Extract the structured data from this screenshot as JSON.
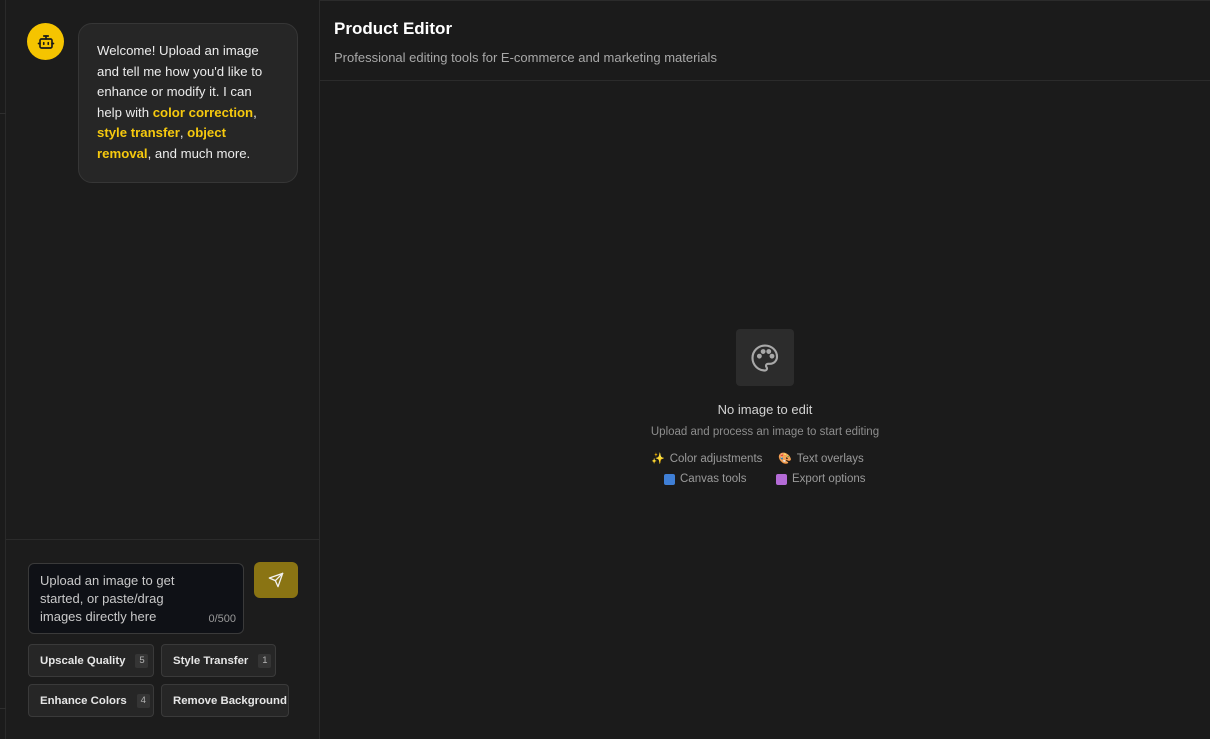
{
  "chat": {
    "welcome": {
      "part1": "Welcome! Upload an image and tell me how you'd like to enhance or modify it. I can help with ",
      "link1": "color correction",
      "sep1": ", ",
      "link2": "style transfer",
      "sep2": ", ",
      "link3": "object removal",
      "part2": ", and much more."
    },
    "input": {
      "placeholder": "Upload an image to get started, or paste/drag images directly here",
      "char_count": "0/500"
    },
    "quick_actions": [
      {
        "label": "Upscale Quality",
        "count": "5"
      },
      {
        "label": "Style Transfer",
        "count": "1"
      },
      {
        "label": "Enhance Colors",
        "count": "4"
      },
      {
        "label": "Remove Background"
      }
    ]
  },
  "editor": {
    "title": "Product Editor",
    "subtitle": "Professional editing tools for E-commerce and marketing materials",
    "empty_state": {
      "title": "No image to edit",
      "subtitle": "Upload and process an image to start editing",
      "features": [
        {
          "label": "Color adjustments",
          "icon": "sparkles-icon"
        },
        {
          "label": "Text overlays",
          "icon": "palette-icon"
        },
        {
          "label": "Canvas tools",
          "icon": "refresh-icon"
        },
        {
          "label": "Export options",
          "icon": "package-icon"
        }
      ]
    }
  },
  "colors": {
    "accent": "#f5c400",
    "send_button": "#8a7413",
    "background": "#1b1b1b"
  }
}
